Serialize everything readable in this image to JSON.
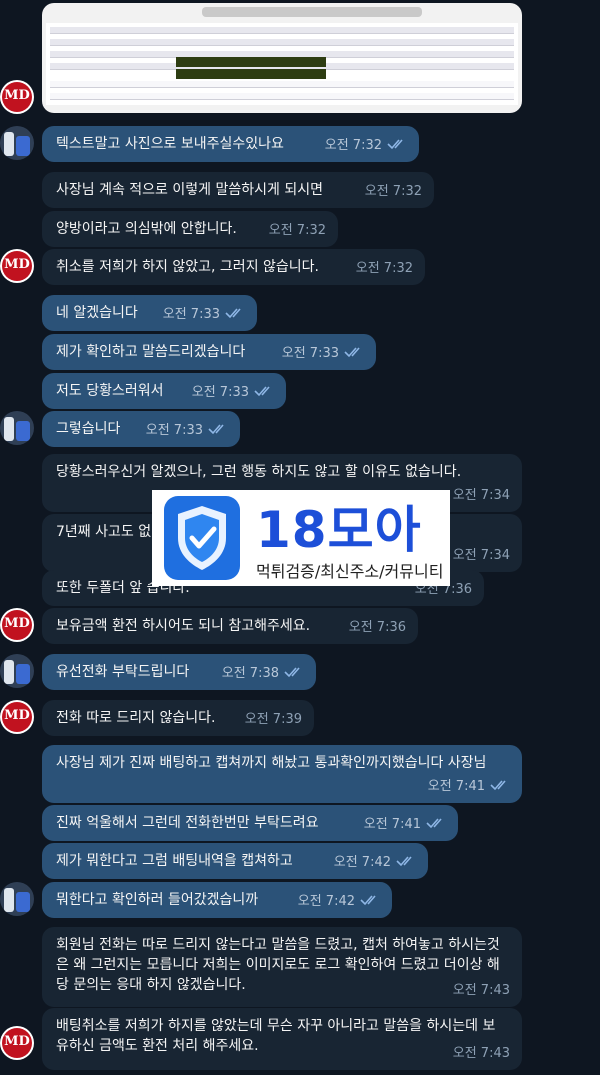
{
  "watermark": {
    "title": "18모아",
    "subtitle": "먹튀검증/최신주소/커뮤니티"
  },
  "messages": [
    {
      "text": "텍스트말고 사진으로 보내주실수있나요",
      "time": "오전 7:32"
    },
    {
      "text": "사장님 계속 적으로 이렇게 말씀하시게 되시면",
      "time": "오전 7:32"
    },
    {
      "text": "양방이라고 의심밖에 안합니다.",
      "time": "오전 7:32"
    },
    {
      "text": "취소를 저희가 하지 않았고, 그러지 않습니다.",
      "time": "오전 7:32"
    },
    {
      "text": "네 알겠습니다",
      "time": "오전 7:33"
    },
    {
      "text": "제가 확인하고 말씀드리겠습니다",
      "time": "오전 7:33"
    },
    {
      "text": "저도 당황스러워서",
      "time": "오전 7:33"
    },
    {
      "text": "그렇습니다",
      "time": "오전 7:33"
    },
    {
      "text": "당황스러우신거 알겠으나, 그런 행동 하지도 않고 할 이유도 없습니다.",
      "time": "오전 7:34"
    },
    {
      "text": "7년째 사고도 없                                                     없네요. 비밀번호나 다",
      "time": "오전 7:34"
    },
    {
      "text": "또한 두폴더 앞                                              습니다.",
      "time": "오전 7:36"
    },
    {
      "text": "보유금액 환전 하시어도 되니 참고해주세요.",
      "time": "오전 7:36"
    },
    {
      "text": "유선전화 부탁드립니다",
      "time": "오전 7:38"
    },
    {
      "text": "전화 따로 드리지 않습니다.",
      "time": "오전 7:39"
    },
    {
      "text": "사장님 제가 진짜 배팅하고 캡쳐까지 해놨고 통과확인까지했습니다 사장님",
      "time": "오전 7:41"
    },
    {
      "text": "진짜 억울해서 그런데 전화한번만 부탁드려요",
      "time": "오전 7:41"
    },
    {
      "text": "제가 뭐한다고 그럼 배팅내역을 캡쳐하고",
      "time": "오전 7:42"
    },
    {
      "text": "뭐한다고 확인하러 들어갔겠습니까",
      "time": "오전 7:42"
    },
    {
      "text": "회원님 전화는 따로 드리지 않는다고 말씀을 드렸고, 캡처 하여놓고 하시는것은 왜 그런지는 모릅니다 저희는 이미지로도 로그 확인하여 드렸고 더이상 해당 문의는 응대 하지 않겠습니다.",
      "time": "오전 7:43"
    },
    {
      "text": "배팅취소를 저희가 하지를 않았는데 무슨 자꾸 아니라고 말씀을 하시는데 보유하신 금액도 환전 처리 해주세요.",
      "time": "오전 7:43"
    }
  ],
  "avatars": {
    "support": "MD",
    "user": "user-avatar"
  }
}
